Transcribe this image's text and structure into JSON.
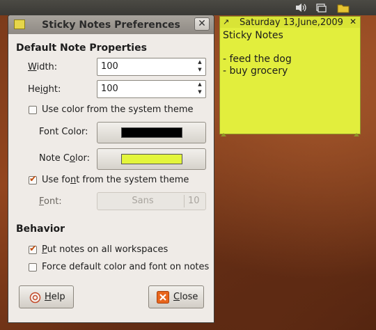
{
  "dialog": {
    "title": "Sticky Notes Preferences",
    "close_glyph": "✕",
    "section_defaults": "Default Note Properties",
    "width": {
      "label_u": "W",
      "label_rest": "idth:",
      "value": "100"
    },
    "height": {
      "label_pre": "He",
      "label_u": "i",
      "label_rest": "ght:",
      "value": "100"
    },
    "use_color_theme": {
      "label": "Use color from the system theme",
      "checked": false
    },
    "font_color": {
      "label": "Font Color:",
      "color": "#000000"
    },
    "note_color": {
      "label_pre": "Note C",
      "label_u": "o",
      "label_rest": "lor:",
      "color": "#e3f53b"
    },
    "use_font_theme": {
      "label_pre": "Use fo",
      "label_u": "n",
      "label_rest": "t from the system theme",
      "checked": true
    },
    "font": {
      "label_u": "F",
      "label_rest": "ont:",
      "name": "Sans",
      "size": "10"
    },
    "section_behavior": "Behavior",
    "all_workspaces": {
      "label_u": "P",
      "label_rest": "ut notes on all workspaces",
      "checked": true
    },
    "force_default": {
      "label": "Force default color and font on notes",
      "checked": false
    },
    "help_button": {
      "label_u": "H",
      "label_rest": "elp"
    },
    "close_button": {
      "label_u": "C",
      "label_rest": "lose"
    }
  },
  "note": {
    "date": "Saturday 13,June,2009",
    "close_glyph": "✕",
    "pin_glyph": "↗",
    "body": "Sticky Notes\n\n- feed the dog\n- buy grocery",
    "color": "#e2ee3d"
  },
  "tray": {
    "icons": [
      "volume-icon",
      "window-switcher-icon",
      "folder-icon"
    ]
  }
}
